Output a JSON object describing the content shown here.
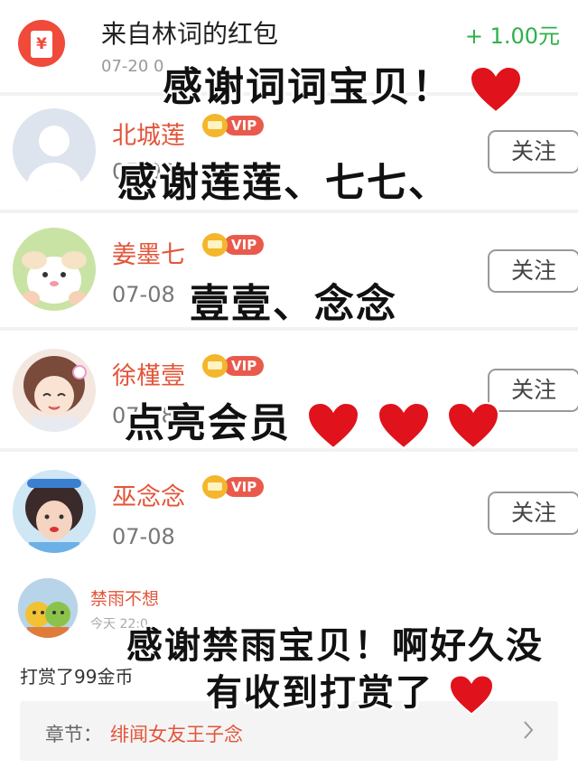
{
  "red_packet": {
    "title": "来自林词的红包",
    "date": "07-20 0",
    "amount": "+ 1.00元",
    "icon": "red-envelope-icon"
  },
  "users": [
    {
      "name": "北城莲",
      "vip": "VIP",
      "date": "07-08",
      "follow": "关注",
      "avatar": "default-avatar"
    },
    {
      "name": "姜墨七",
      "vip": "VIP",
      "date": "07-08",
      "follow": "关注",
      "avatar": "cartoon-avatar"
    },
    {
      "name": "徐槿壹",
      "vip": "VIP",
      "date": "07-08",
      "follow": "关注",
      "avatar": "anime-girl-avatar"
    },
    {
      "name": "巫念念",
      "vip": "VIP",
      "date": "07-08",
      "follow": "关注",
      "avatar": "photo-avatar"
    }
  ],
  "comment": {
    "name": "禁雨不想",
    "time": "今天 22:0",
    "text": "打赏了99金币",
    "chapter_label": "章节：",
    "chapter_value": "绯闻女友王子念"
  },
  "captions": {
    "line1": "感谢词词宝贝！",
    "line2": "感谢莲莲、七七、",
    "line3": "壹壹、念念",
    "line4": "点亮会员",
    "line5": "感谢禁雨宝贝！啊好久没",
    "line6": "有收到打赏了"
  },
  "colors": {
    "accent_red": "#e2553a",
    "amount_green": "#2db14a",
    "heart_red": "#e0121b"
  }
}
